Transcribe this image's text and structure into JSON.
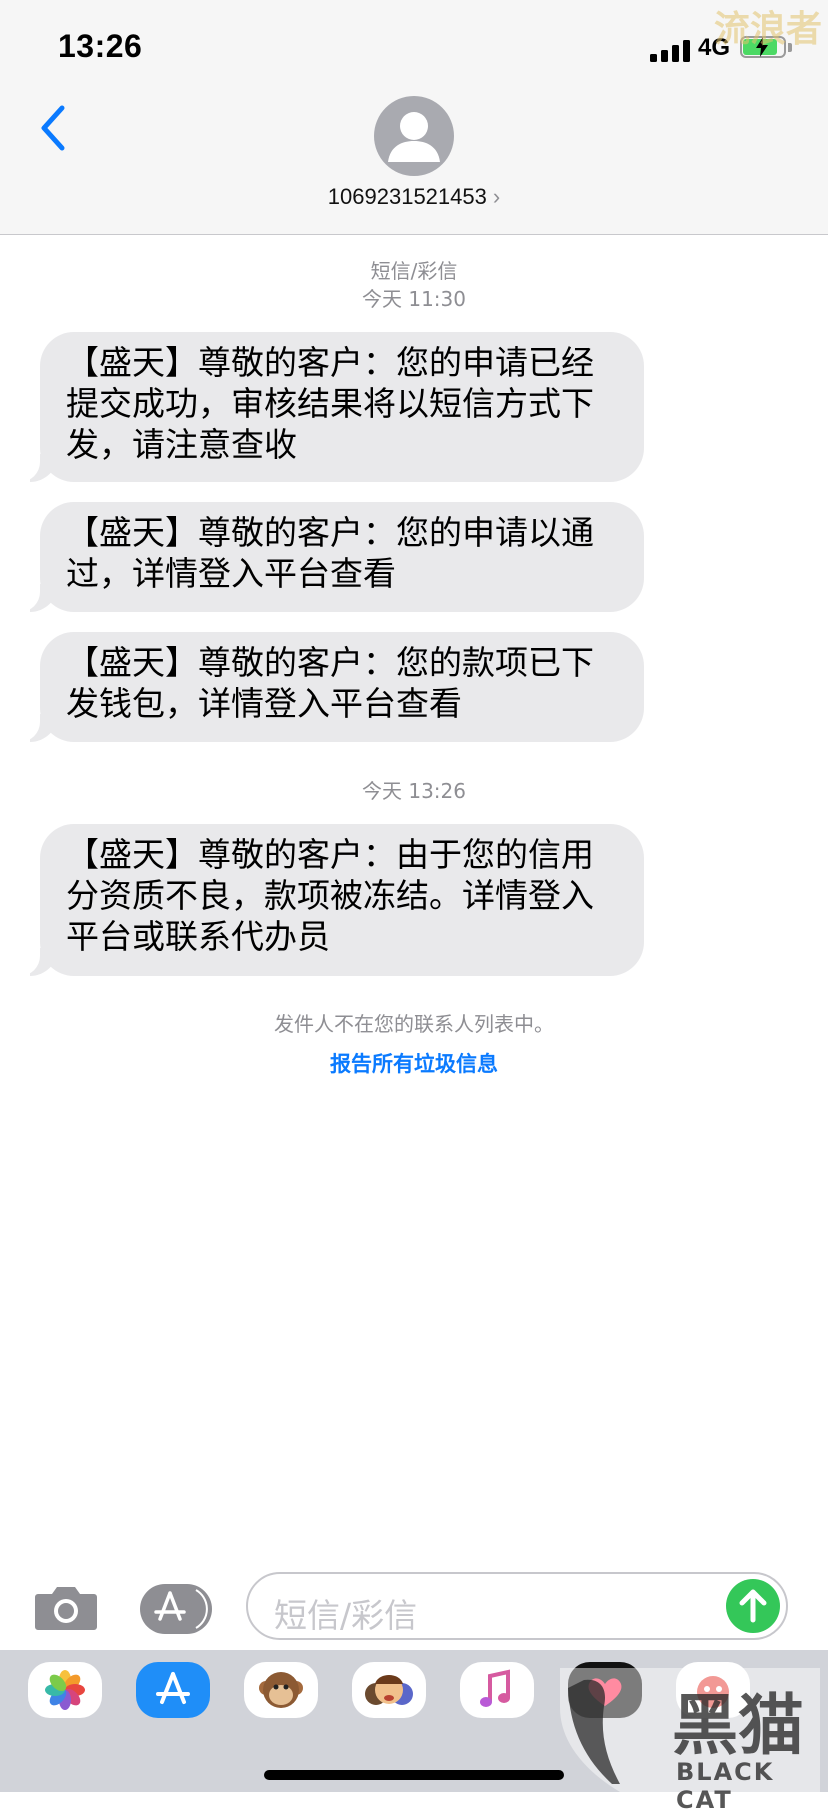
{
  "status_bar": {
    "time": "13:26",
    "network": "4G",
    "battery_level": 0.8,
    "battery_color": "#4cd964"
  },
  "watermark_top": "流浪者",
  "header": {
    "back_icon": "chevron-left-icon",
    "avatar_icon": "person-silhouette-icon",
    "contact_number": "1069231521453",
    "contact_chevron": "›"
  },
  "conversation": {
    "service_label": "短信/彩信",
    "groups": [
      {
        "timestamp": "今天 11:30",
        "messages": [
          "【盛天】尊敬的客户：您的申请已经提交成功，审核结果将以短信方式下发，请注意查收",
          "【盛天】尊敬的客户：您的申请以通过，详情登入平台查看",
          "【盛天】尊敬的客户：您的款项已下发钱包，详情登入平台查看"
        ]
      },
      {
        "timestamp": "今天 13:26",
        "messages": [
          "【盛天】尊敬的客户：由于您的信用分资质不良，款项被冻结。详情登入平台或联系代办员"
        ]
      }
    ],
    "spam_note": "发件人不在您的联系人列表中。",
    "spam_link": "报告所有垃圾信息"
  },
  "compose": {
    "placeholder": "短信/彩信",
    "camera_icon": "camera-icon",
    "apps_icon": "app-store-icon",
    "send_icon": "arrow-up-icon",
    "send_color": "#34c759"
  },
  "app_drawer": [
    {
      "name": "photos-app-icon"
    },
    {
      "name": "app-store-app-icon"
    },
    {
      "name": "animoji-monkey-icon"
    },
    {
      "name": "memoji-icon"
    },
    {
      "name": "music-app-icon"
    },
    {
      "name": "digital-touch-icon"
    },
    {
      "name": "sticker-app-icon"
    }
  ],
  "watermark_bottom": {
    "text": "黑猫",
    "latin": "BLACK CAT"
  }
}
